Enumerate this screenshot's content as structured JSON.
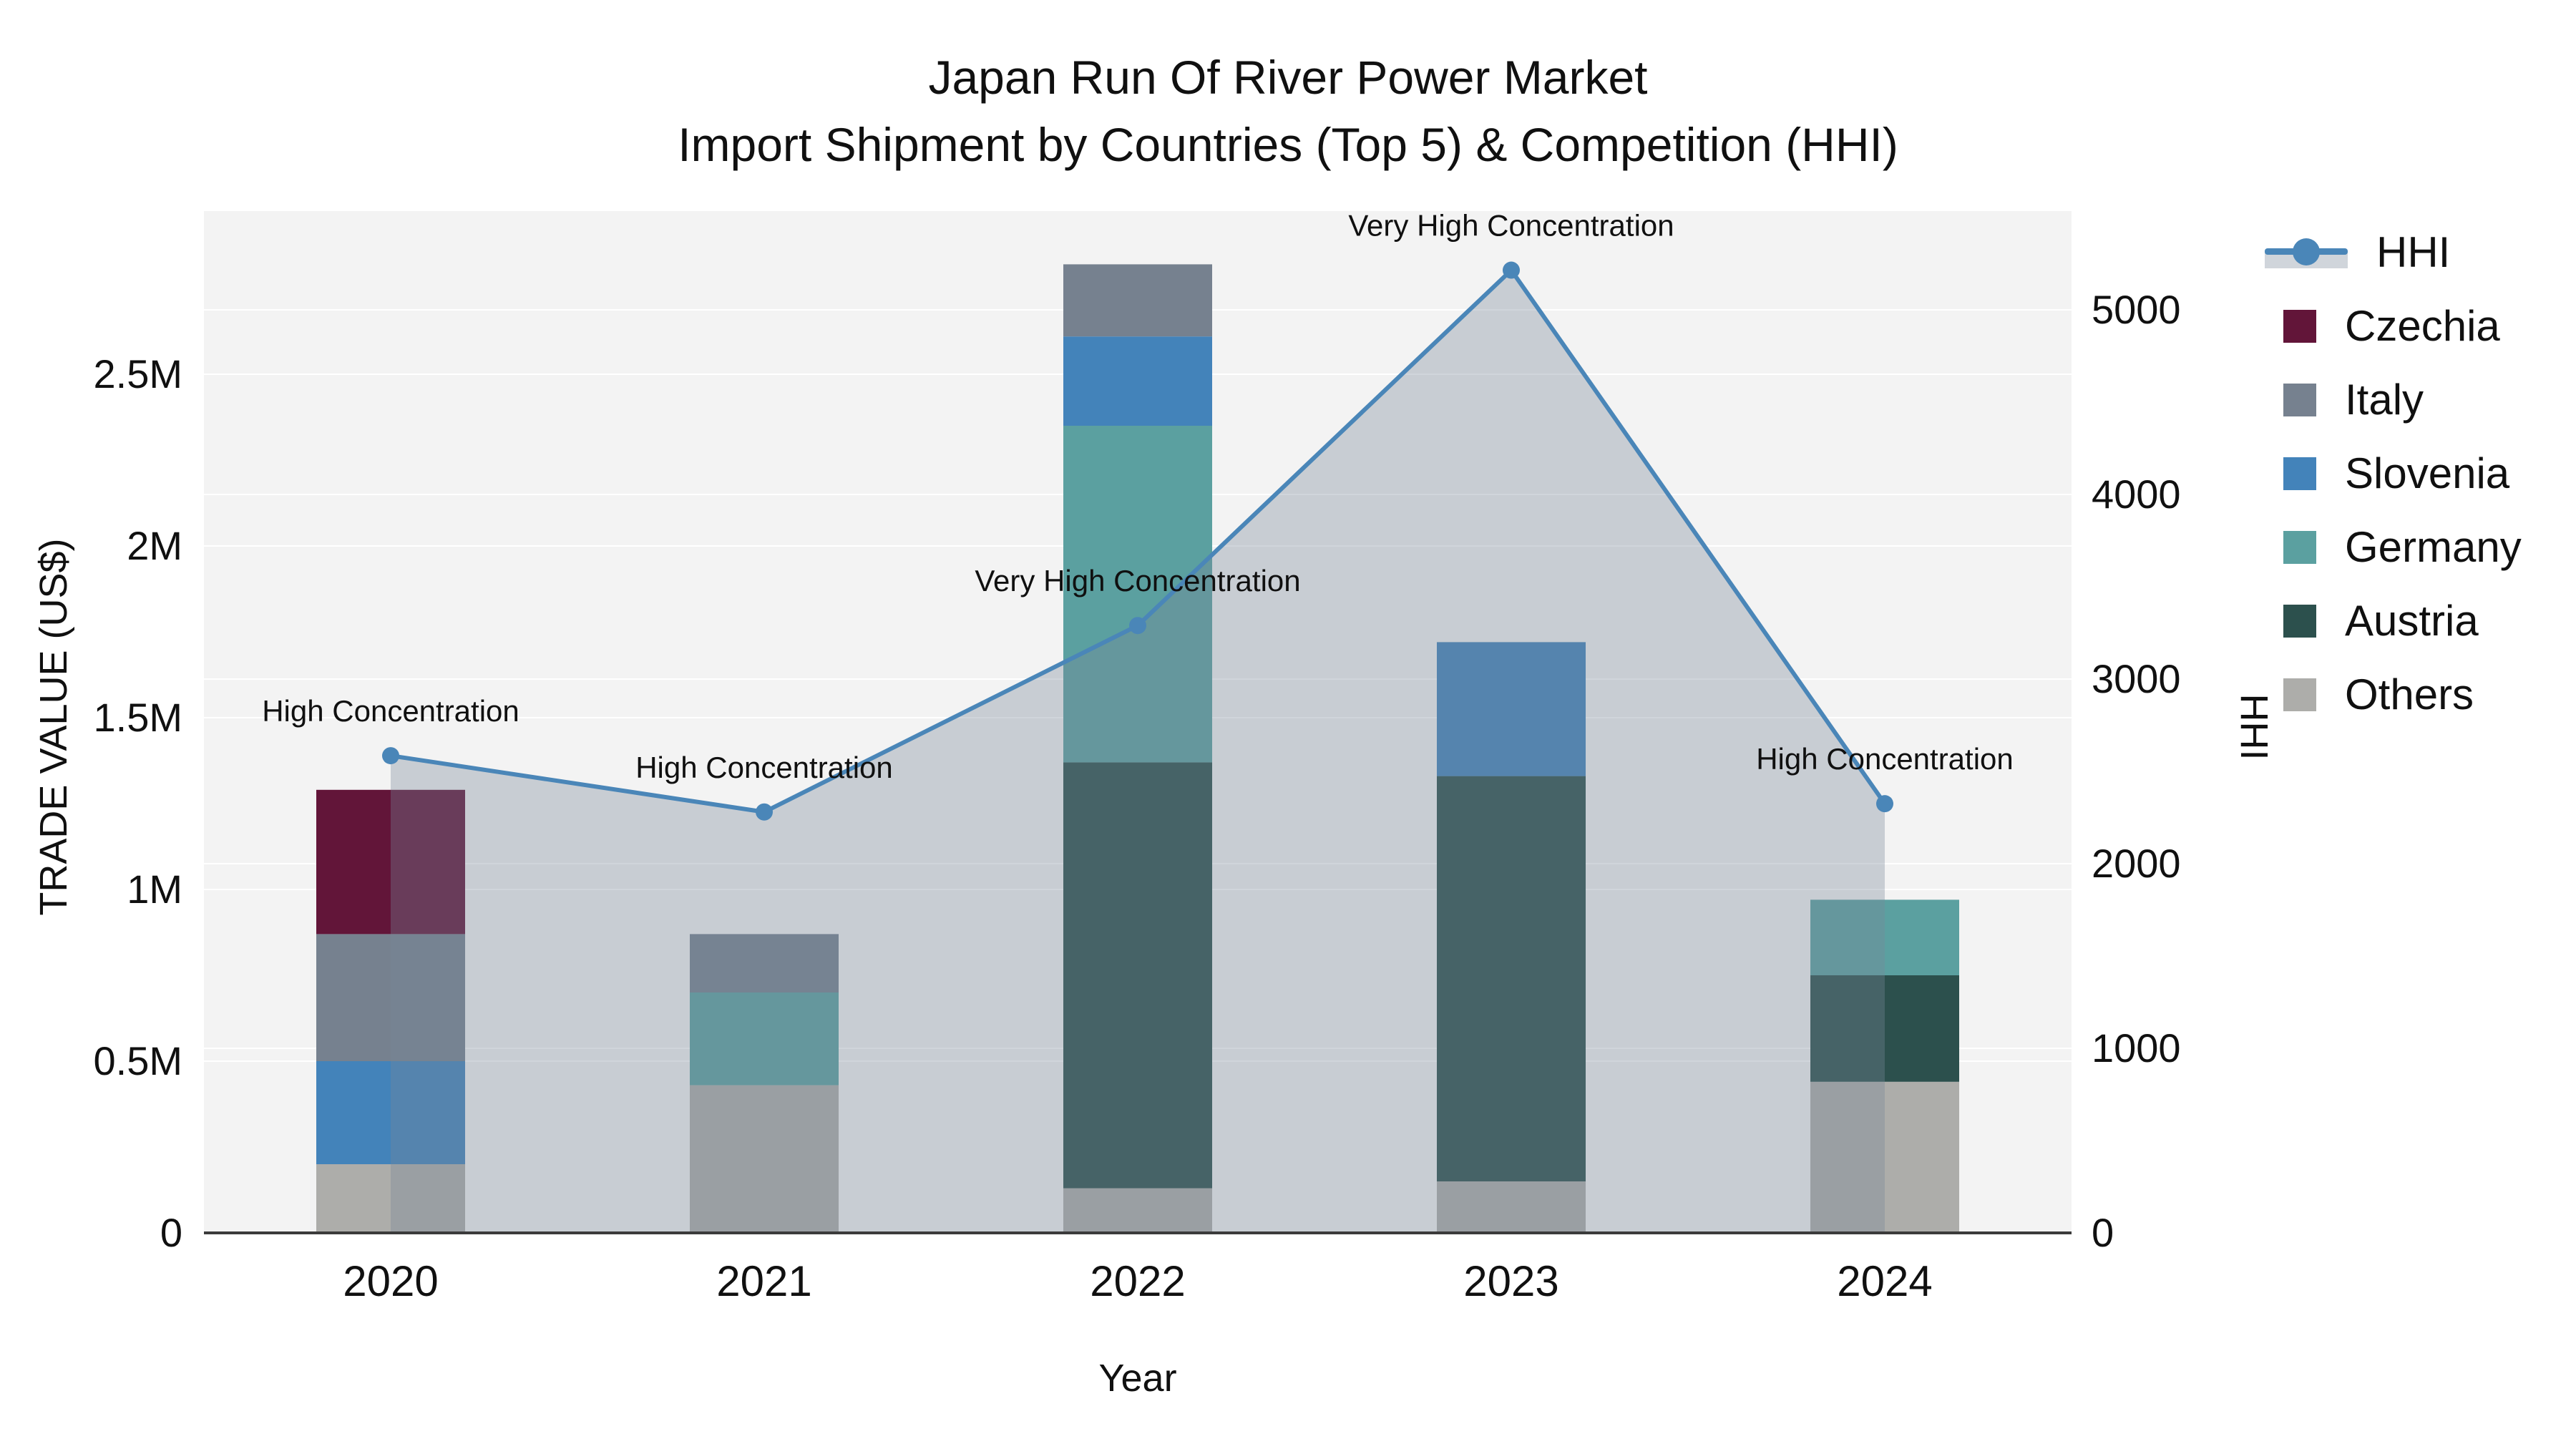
{
  "title": {
    "line1": "Japan Run Of River Power Market",
    "line2": "Import Shipment by Countries (Top 5) & Competition (HHI)"
  },
  "chart_data": {
    "type": "bar+line",
    "title": "Japan Run Of River Power Market Import Shipment by Countries (Top 5) & Competition (HHI)",
    "xlabel": "Year",
    "ylabel": "TRADE VALUE (US$)",
    "y2label": "HHI",
    "categories": [
      "2020",
      "2021",
      "2022",
      "2023",
      "2024"
    ],
    "series": [
      {
        "name": "Czechia",
        "color": "#621539",
        "values": [
          420000,
          0,
          0,
          0,
          0
        ]
      },
      {
        "name": "Italy",
        "color": "#76818f",
        "values": [
          370000,
          170000,
          210000,
          0,
          0
        ]
      },
      {
        "name": "Slovenia",
        "color": "#4383ba",
        "values": [
          300000,
          0,
          260000,
          390000,
          0
        ]
      },
      {
        "name": "Germany",
        "color": "#5ba0a0",
        "values": [
          0,
          270000,
          980000,
          0,
          220000
        ]
      },
      {
        "name": "Austria",
        "color": "#2c504d",
        "values": [
          0,
          0,
          1240000,
          1180000,
          310000
        ]
      },
      {
        "name": "Others",
        "color": "#adadaa",
        "values": [
          200000,
          430000,
          130000,
          150000,
          440000
        ]
      }
    ],
    "stack_bottom_to_top": [
      "Others",
      "Austria",
      "Germany",
      "Slovenia",
      "Italy",
      "Czechia"
    ],
    "hhi_line": {
      "name": "HHI",
      "color": "#4a86b8",
      "area_fill": "rgba(119,136,153,0.35)",
      "values": [
        2585,
        2280,
        3290,
        5215,
        2325
      ]
    },
    "annotations": [
      {
        "x": "2020",
        "text": "High Concentration"
      },
      {
        "x": "2021",
        "text": "High Concentration"
      },
      {
        "x": "2022",
        "text": "Very High Concentration"
      },
      {
        "x": "2023",
        "text": "Very High Concentration"
      },
      {
        "x": "2024",
        "text": "High Concentration"
      }
    ],
    "ylim": [
      0,
      2975000
    ],
    "y2lim": [
      0,
      5535
    ],
    "yticks": [
      {
        "v": 0,
        "label": "0"
      },
      {
        "v": 500000,
        "label": "0.5M"
      },
      {
        "v": 1000000,
        "label": "1M"
      },
      {
        "v": 1500000,
        "label": "1.5M"
      },
      {
        "v": 2000000,
        "label": "2M"
      },
      {
        "v": 2500000,
        "label": "2.5M"
      }
    ],
    "y2ticks": [
      {
        "v": 0,
        "label": "0"
      },
      {
        "v": 1000,
        "label": "1000"
      },
      {
        "v": 2000,
        "label": "2000"
      },
      {
        "v": 3000,
        "label": "3000"
      },
      {
        "v": 4000,
        "label": "4000"
      },
      {
        "v": 5000,
        "label": "5000"
      }
    ],
    "grid": true,
    "legend_position": "right",
    "plot_bg": "#f3f3f3",
    "grid_color": "#ffffff",
    "axis_line_color": "#3b3b3b"
  },
  "legend": {
    "line_item_label": "HHI",
    "items": [
      {
        "label": "Czechia",
        "color": "#621539"
      },
      {
        "label": "Italy",
        "color": "#76818f"
      },
      {
        "label": "Slovenia",
        "color": "#4383ba"
      },
      {
        "label": "Germany",
        "color": "#5ba0a0"
      },
      {
        "label": "Austria",
        "color": "#2c504d"
      },
      {
        "label": "Others",
        "color": "#adadaa"
      }
    ]
  }
}
